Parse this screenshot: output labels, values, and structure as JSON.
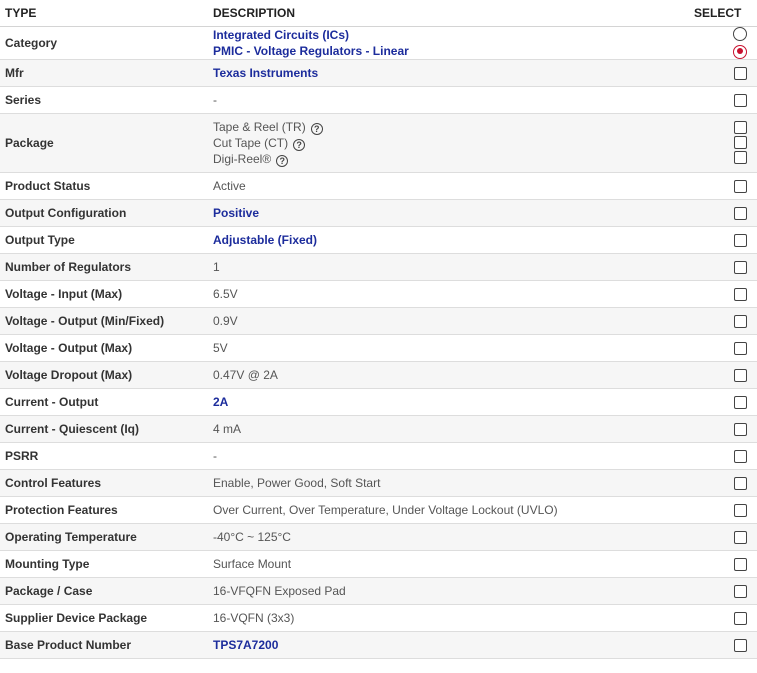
{
  "header": {
    "type": "TYPE",
    "description": "DESCRIPTION",
    "select": "SELECT"
  },
  "rows": {
    "category": {
      "label": "Category",
      "values": [
        "Integrated Circuits (ICs)",
        "PMIC - Voltage Regulators - Linear"
      ]
    },
    "mfr": {
      "label": "Mfr",
      "value": "Texas Instruments"
    },
    "series": {
      "label": "Series",
      "value": "-"
    },
    "package": {
      "label": "Package",
      "values": [
        "Tape & Reel (TR)",
        "Cut Tape (CT)",
        "Digi-Reel®"
      ]
    },
    "product_status": {
      "label": "Product Status",
      "value": "Active"
    },
    "output_configuration": {
      "label": "Output Configuration",
      "value": "Positive"
    },
    "output_type": {
      "label": "Output Type",
      "value": "Adjustable (Fixed)"
    },
    "number_of_regulators": {
      "label": "Number of Regulators",
      "value": "1"
    },
    "voltage_input_max": {
      "label": "Voltage - Input (Max)",
      "value": "6.5V"
    },
    "voltage_output_min_fixed": {
      "label": "Voltage - Output (Min/Fixed)",
      "value": "0.9V"
    },
    "voltage_output_max": {
      "label": "Voltage - Output (Max)",
      "value": "5V"
    },
    "voltage_dropout_max": {
      "label": "Voltage Dropout (Max)",
      "value": "0.47V @ 2A"
    },
    "current_output": {
      "label": "Current - Output",
      "value": "2A"
    },
    "current_quiescent": {
      "label": "Current - Quiescent (Iq)",
      "value": "4 mA"
    },
    "psrr": {
      "label": "PSRR",
      "value": "-"
    },
    "control_features": {
      "label": "Control Features",
      "value": "Enable, Power Good, Soft Start"
    },
    "protection_features": {
      "label": "Protection Features",
      "value": "Over Current, Over Temperature, Under Voltage Lockout (UVLO)"
    },
    "operating_temperature": {
      "label": "Operating Temperature",
      "value": "-40°C ~ 125°C"
    },
    "mounting_type": {
      "label": "Mounting Type",
      "value": "Surface Mount"
    },
    "package_case": {
      "label": "Package / Case",
      "value": "16-VFQFN Exposed Pad"
    },
    "supplier_device_package": {
      "label": "Supplier Device Package",
      "value": "16-VQFN (3x3)"
    },
    "base_product_number": {
      "label": "Base Product Number",
      "value": "TPS7A7200"
    }
  },
  "state": {
    "category_radio_selected": 1,
    "all_checked": false
  },
  "colors": {
    "link": "#1c2c9c",
    "radio_selected": "#c8102e"
  },
  "icons": {
    "help": "question-circle-icon"
  }
}
